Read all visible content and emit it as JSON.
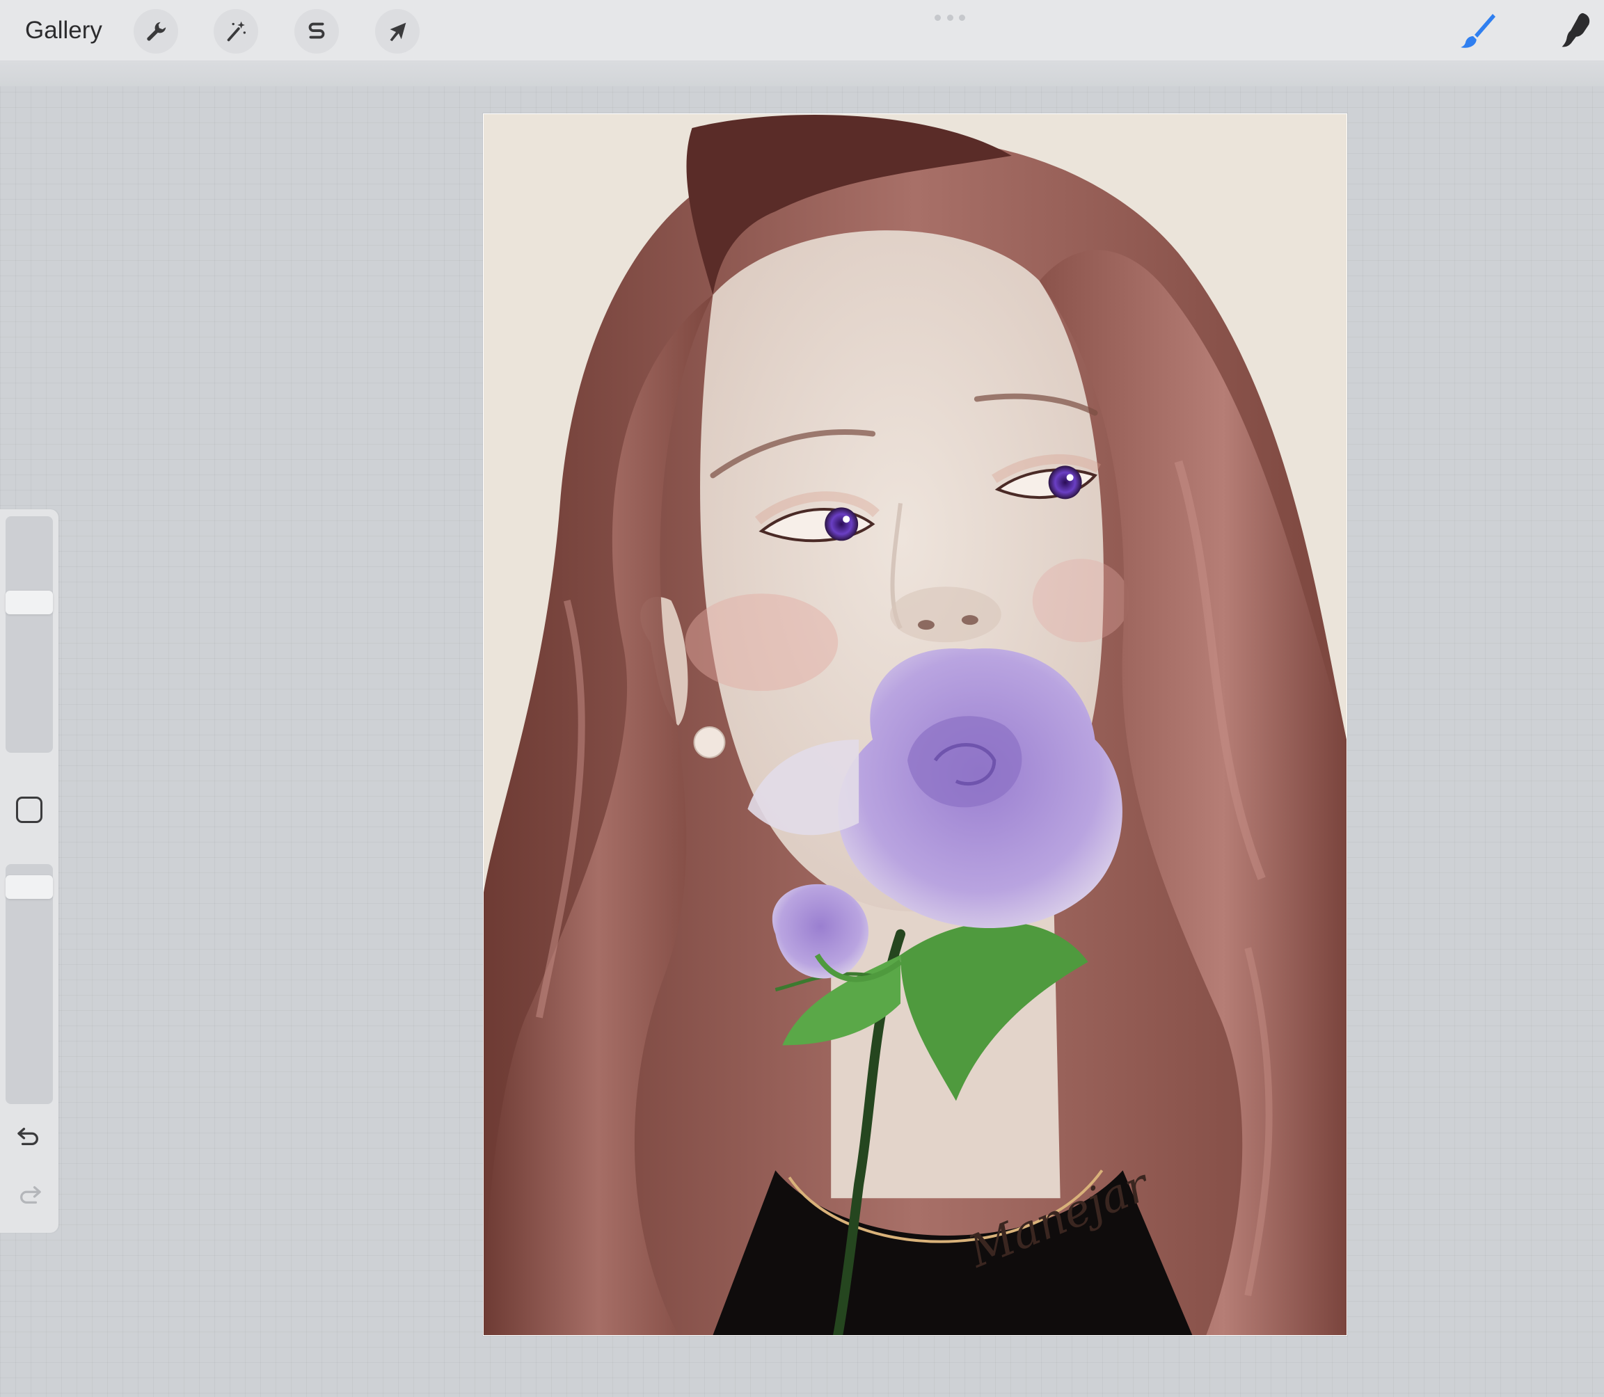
{
  "toolbar": {
    "gallery_label": "Gallery",
    "tools": [
      {
        "name": "actions",
        "icon": "wrench-icon"
      },
      {
        "name": "adjustments",
        "icon": "magic-wand-icon"
      },
      {
        "name": "selection",
        "icon": "selection-s-icon"
      },
      {
        "name": "transform",
        "icon": "arrow-cursor-icon"
      }
    ],
    "right_tools": [
      {
        "name": "brush",
        "icon": "paintbrush-icon",
        "active": true,
        "color": "#2f7ff0"
      },
      {
        "name": "smudge",
        "icon": "smudge-finger-icon",
        "active": false,
        "color": "#2c2c2e"
      }
    ]
  },
  "sidebar": {
    "brush_size_level": 0.65,
    "opacity_level": 0.95,
    "modify_icon": "square-modify-icon",
    "undo_icon": "undo-icon",
    "redo_icon": "redo-icon",
    "redo_enabled": false
  },
  "canvas": {
    "signature": "Manejar",
    "background_color": "#e9e2d8",
    "hair_color": "#9c6660",
    "rose_color": "#a58bd6",
    "leaf_color": "#4f9a3e"
  }
}
